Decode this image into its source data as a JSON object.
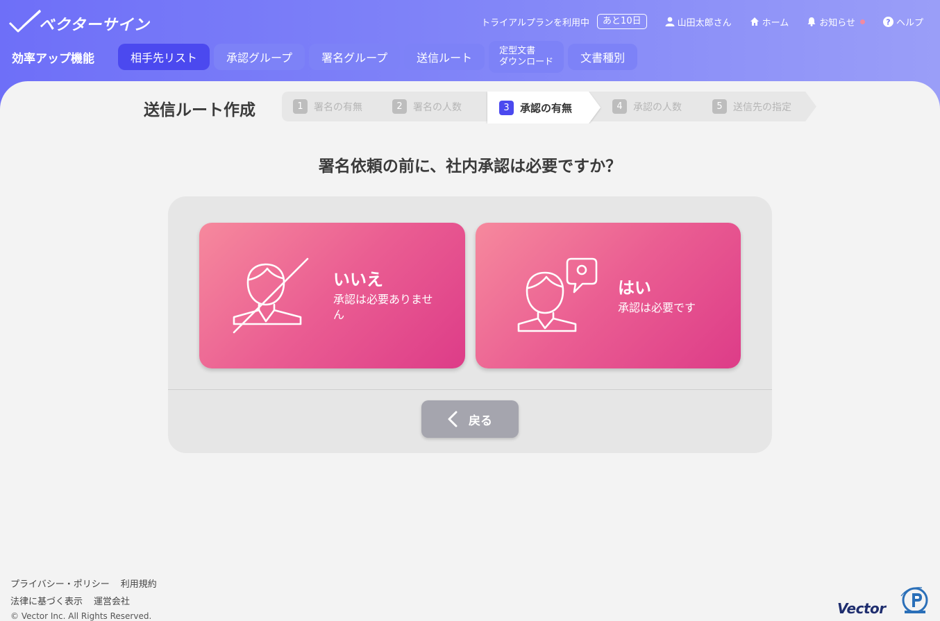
{
  "header": {
    "logo_text": "ベクターサイン",
    "trial_text": "トライアルプランを利用中",
    "trial_badge": "あと10日",
    "user": "山田太郎さん",
    "home": "ホーム",
    "notice": "お知らせ",
    "help": "ヘルプ"
  },
  "nav": {
    "title": "効率アップ機能",
    "items": [
      {
        "label": "相手先リスト"
      },
      {
        "label": "承認グループ"
      },
      {
        "label": "署名グループ"
      },
      {
        "label": "送信ルート"
      },
      {
        "label_line1": "定型文書",
        "label_line2": "ダウンロード"
      },
      {
        "label": "文書種別"
      }
    ]
  },
  "page": {
    "heading": "送信ルート作成",
    "steps": [
      {
        "num": "1",
        "label": "署名の有無"
      },
      {
        "num": "2",
        "label": "署名の人数"
      },
      {
        "num": "3",
        "label": "承認の有無"
      },
      {
        "num": "4",
        "label": "承認の人数"
      },
      {
        "num": "5",
        "label": "送信先の指定"
      }
    ],
    "question": "署名依頼の前に、社内承認は必要ですか？",
    "choices": {
      "no": {
        "title": "いいえ",
        "sub": "承認は必要ありません"
      },
      "yes": {
        "title": "はい",
        "sub": "承認は必要です"
      }
    },
    "back_label": "戻る"
  },
  "footer": {
    "privacy": "プライバシー・ポリシー",
    "terms": "利用規約",
    "law": "法律に基づく表示",
    "company": "運営会社",
    "copyright": "© Vector Inc. All Rights Reserved.",
    "vector_logo": "Vector"
  },
  "colors": {
    "header_start": "#6e6ff8",
    "nav_active": "#4b49ef",
    "nav_button": "#7d82f7",
    "choice_start": "#f6899d",
    "choice_end": "#dd3c88",
    "back_button": "#a5a5ae",
    "panel_bg": "#f3f3f3"
  }
}
